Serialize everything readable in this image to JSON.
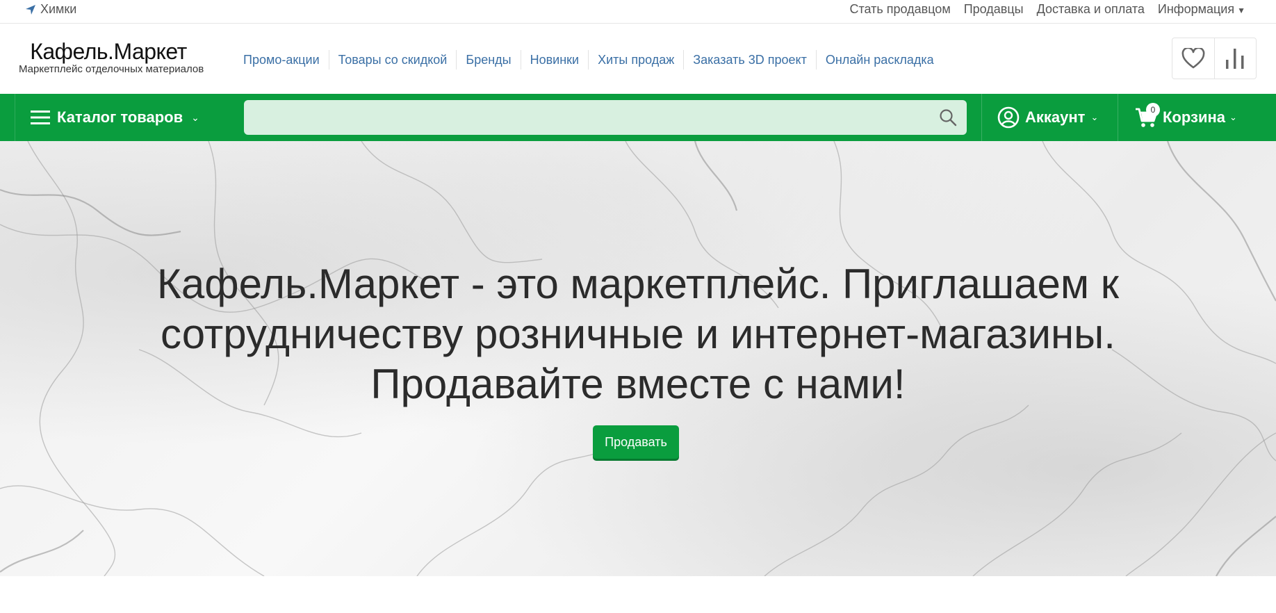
{
  "topbar": {
    "city": "Химки",
    "links": [
      "Стать продавцом",
      "Продавцы",
      "Доставка и оплата",
      "Информация"
    ]
  },
  "header": {
    "logo_name": "Кафель.Маркет",
    "logo_tagline": "Маркетплейс отделочных материалов",
    "nav": [
      "Промо-акции",
      "Товары со скидкой",
      "Бренды",
      "Новинки",
      "Хиты продаж",
      "Заказать 3D проект",
      "Онлайн раскладка"
    ],
    "icons": [
      "heart-icon",
      "bar-chart-icon"
    ]
  },
  "greenbar": {
    "catalog_label": "Каталог товаров",
    "search_placeholder": "",
    "account_label": "Аккаунт",
    "cart_label": "Корзина",
    "cart_count": "0"
  },
  "hero": {
    "headline": "Кафель.Маркет - это маркетплейс. Приглашаем к сотрудничеству розничные и интернет-магазины. Продавайте вместе с нами!",
    "button_label": "Продавать"
  },
  "colors": {
    "brand_green": "#0a9d3e",
    "search_bg": "#d8f0e0",
    "link_blue": "#3a6fa5"
  }
}
